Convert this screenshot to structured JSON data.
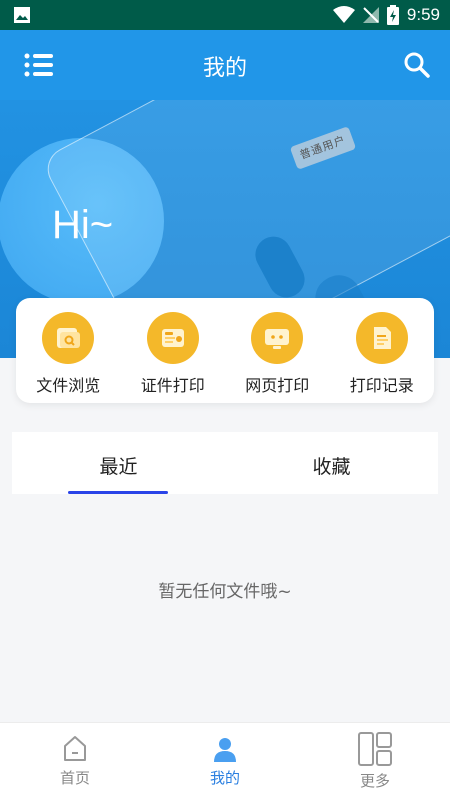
{
  "status_bar": {
    "time": "9:59"
  },
  "header": {
    "title": "我的"
  },
  "hero": {
    "greeting": "Hi~",
    "badge": "普通用户"
  },
  "actions": [
    {
      "label": "文件浏览",
      "icon": "file-browse-icon"
    },
    {
      "label": "证件打印",
      "icon": "id-print-icon"
    },
    {
      "label": "网页打印",
      "icon": "web-print-icon"
    },
    {
      "label": "打印记录",
      "icon": "print-record-icon"
    }
  ],
  "tabs": [
    {
      "label": "最近",
      "active": true
    },
    {
      "label": "收藏",
      "active": false
    }
  ],
  "empty_text": "暂无任何文件哦~",
  "bottom_nav": [
    {
      "label": "首页",
      "icon": "home-icon",
      "active": false
    },
    {
      "label": "我的",
      "icon": "user-icon",
      "active": true
    },
    {
      "label": "更多",
      "icon": "grid-icon",
      "active": false
    }
  ],
  "colors": {
    "primary": "#2196e8",
    "accent": "#f4b82a",
    "tab_underline": "#2a44e8",
    "status_bar": "#005b49"
  }
}
